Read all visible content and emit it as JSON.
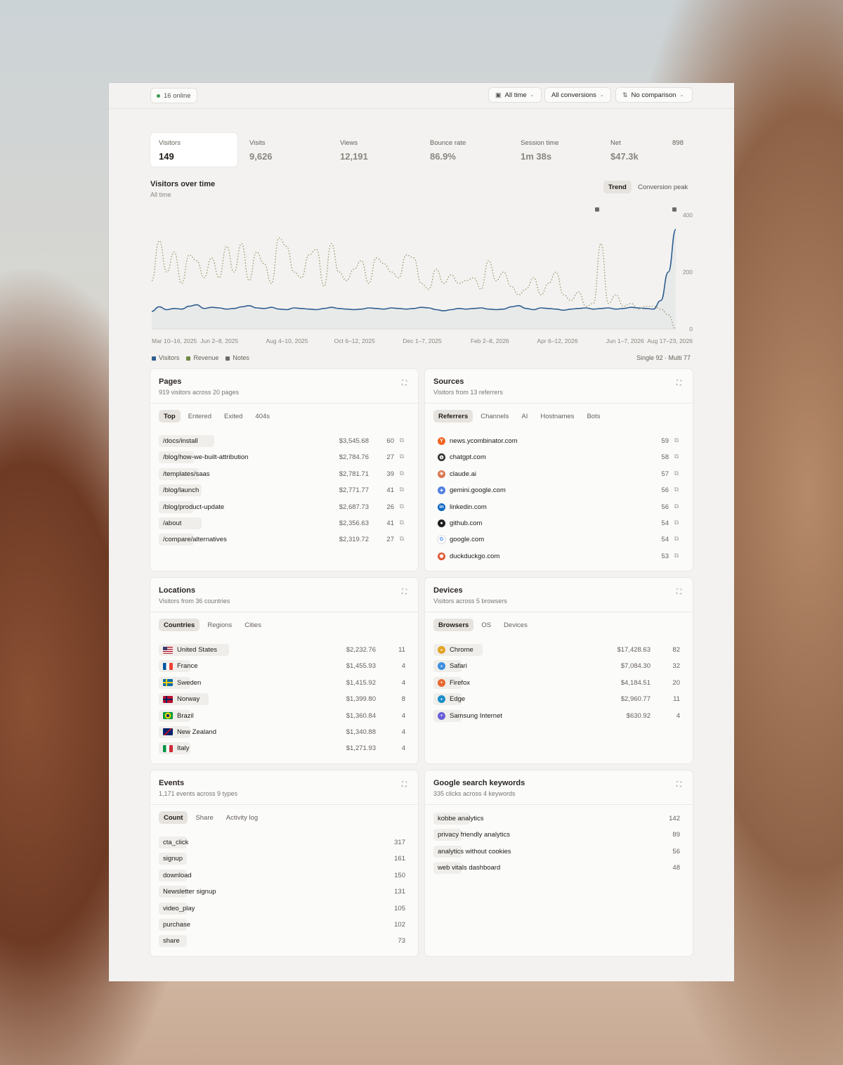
{
  "topbar": {
    "online": "16 online",
    "range": "All time",
    "conversions": "All conversions",
    "comparison": "No comparison"
  },
  "stats": [
    {
      "label": "Visitors",
      "value": "149"
    },
    {
      "label": "Visits",
      "value": "9,626"
    },
    {
      "label": "Views",
      "value": "12,191"
    },
    {
      "label": "Bounce rate",
      "value": "86.9%"
    },
    {
      "label": "Session time",
      "value": "1m 38s"
    },
    {
      "label": "Net",
      "value": "$47.3k"
    }
  ],
  "stats_extra": "898",
  "chart": {
    "title": "Visitors over time",
    "subtitle": "All time",
    "toggle": [
      "Trend",
      "Conversion peak"
    ],
    "legend": [
      "Visitors",
      "Revenue",
      "Notes"
    ],
    "legend_right": "Single 92 · Multi 77"
  },
  "chart_data": {
    "type": "line",
    "x_ticks": [
      "Mar 10–16, 2025",
      "Jun 2–8, 2025",
      "Aug 4–10, 2025",
      "Oct 6–12, 2025",
      "Dec 1–7, 2025",
      "Feb 2–8, 2026",
      "Apr 6–12, 2026",
      "Jun 1–7, 2026",
      "Aug 17–23, 2026"
    ],
    "ylim": [
      0,
      400
    ],
    "y_ticks": [
      "400",
      "200",
      "0"
    ],
    "series": [
      {
        "name": "Visitors",
        "color": "#2f5f91",
        "values": [
          62,
          78,
          68,
          72,
          70,
          80,
          85,
          72,
          76,
          74,
          70,
          72,
          78,
          82,
          74,
          72,
          76,
          70,
          68,
          74,
          72,
          70,
          68,
          72,
          76,
          72,
          70,
          68,
          70,
          74,
          72,
          70,
          74,
          72,
          70,
          72,
          76,
          74,
          68,
          64,
          68,
          72,
          70,
          72,
          74,
          70,
          68,
          70,
          78,
          82,
          72,
          68,
          74,
          72,
          70,
          66,
          70,
          72,
          74,
          70,
          72,
          74,
          70,
          72,
          76,
          74,
          72,
          70,
          100,
          200,
          350
        ]
      },
      {
        "name": "Revenue",
        "color": "#9c946a",
        "values": [
          170,
          310,
          200,
          270,
          160,
          260,
          240,
          180,
          250,
          180,
          290,
          200,
          300,
          170,
          270,
          230,
          160,
          320,
          290,
          200,
          180,
          260,
          280,
          150,
          300,
          200,
          170,
          210,
          240,
          160,
          250,
          230,
          200,
          180,
          260,
          250,
          160,
          140,
          210,
          160,
          190,
          160,
          170,
          180,
          140,
          240,
          170,
          200,
          150,
          120,
          140,
          180,
          120,
          160,
          200,
          120,
          100,
          130,
          80,
          90,
          300,
          90,
          120,
          80,
          90,
          70,
          80,
          80,
          70,
          50,
          0
        ]
      }
    ],
    "notes_markers": [
      "Jul 2026",
      "Aug 2026"
    ]
  },
  "pages": {
    "title": "Pages",
    "subtitle": "919 visitors across 20 pages",
    "tabs": [
      "Top",
      "Entered",
      "Exited",
      "404s"
    ],
    "rows": [
      {
        "label": "/docs/install",
        "money": "$3,545.68",
        "count": "60",
        "share": 0.22
      },
      {
        "label": "/blog/how-we-built-attribution",
        "money": "$2,784.76",
        "count": "27",
        "share": 0.12
      },
      {
        "label": "/templates/saas",
        "money": "$2,781.71",
        "count": "39",
        "share": 0.16
      },
      {
        "label": "/blog/launch",
        "money": "$2,771.77",
        "count": "41",
        "share": 0.17
      },
      {
        "label": "/blog/product-update",
        "money": "$2,687.73",
        "count": "26",
        "share": 0.11
      },
      {
        "label": "/about",
        "money": "$2,356.63",
        "count": "41",
        "share": 0.17
      },
      {
        "label": "/compare/alternatives",
        "money": "$2,319.72",
        "count": "27",
        "share": 0.12
      }
    ]
  },
  "sources": {
    "title": "Sources",
    "subtitle": "Visitors from 13 referrers",
    "tabs": [
      "Referrers",
      "Channels",
      "AI",
      "Hostnames",
      "Bots"
    ],
    "rows": [
      {
        "label": "news.ycombinator.com",
        "icon": "ycombinator-icon",
        "glyph": "Y",
        "color": "#f26522",
        "count": "59"
      },
      {
        "label": "chatgpt.com",
        "icon": "chatgpt-icon",
        "glyph": "❂",
        "color": "#333333",
        "count": "58"
      },
      {
        "label": "claude.ai",
        "icon": "claude-icon",
        "glyph": "✳",
        "color": "#d9774f",
        "count": "57"
      },
      {
        "label": "gemini.google.com",
        "icon": "gemini-icon",
        "glyph": "✦",
        "color": "#4f7fe0",
        "count": "56"
      },
      {
        "label": "linkedin.com",
        "icon": "linkedin-icon",
        "glyph": "in",
        "color": "#0a66c2",
        "count": "56"
      },
      {
        "label": "github.com",
        "icon": "github-icon",
        "glyph": "●",
        "color": "#1e1e1e",
        "count": "54"
      },
      {
        "label": "google.com",
        "icon": "google-icon",
        "glyph": "G",
        "color": "#ffffff",
        "count": "54"
      },
      {
        "label": "duckduckgo.com",
        "icon": "duckduckgo-icon",
        "glyph": "◉",
        "color": "#de5833",
        "count": "53"
      }
    ]
  },
  "locations": {
    "title": "Locations",
    "subtitle": "Visitors from 36 countries",
    "tabs": [
      "Countries",
      "Regions",
      "Cities"
    ],
    "rows": [
      {
        "label": "United States",
        "flag": "us-flag-icon",
        "money": "$2,232.76",
        "count": "11",
        "share": 0.28
      },
      {
        "label": "France",
        "flag": "fr-flag-icon",
        "money": "$1,455.93",
        "count": "4",
        "share": 0.1
      },
      {
        "label": "Sweden",
        "flag": "se-flag-icon",
        "money": "$1,415.92",
        "count": "4",
        "share": 0.1
      },
      {
        "label": "Norway",
        "flag": "no-flag-icon",
        "money": "$1,399.80",
        "count": "8",
        "share": 0.2
      },
      {
        "label": "Brazil",
        "flag": "br-flag-icon",
        "money": "$1,360.84",
        "count": "4",
        "share": 0.1
      },
      {
        "label": "New Zealand",
        "flag": "nz-flag-icon",
        "money": "$1,340.88",
        "count": "4",
        "share": 0.1
      },
      {
        "label": "Italy",
        "flag": "it-flag-icon",
        "money": "$1,271.93",
        "count": "4",
        "share": 0.1
      }
    ]
  },
  "devices": {
    "title": "Devices",
    "subtitle": "Visitors across 5 browsers",
    "tabs": [
      "Browsers",
      "OS",
      "Devices"
    ],
    "rows": [
      {
        "label": "Chrome",
        "icon": "chrome-icon",
        "color": "#e0a526",
        "money": "$17,428.63",
        "count": "82",
        "share": 0.56
      },
      {
        "label": "Safari",
        "icon": "safari-icon",
        "color": "#3d8ee0",
        "money": "$7,084.30",
        "count": "32",
        "share": 0.22
      },
      {
        "label": "Firefox",
        "icon": "firefox-icon",
        "color": "#e8662e",
        "money": "$4,184.51",
        "count": "20",
        "share": 0.14
      },
      {
        "label": "Edge",
        "icon": "edge-icon",
        "color": "#1c8fc9",
        "money": "$2,960.77",
        "count": "11",
        "share": 0.08
      },
      {
        "label": "Samsung Internet",
        "icon": "samsung-internet-icon",
        "color": "#6a5fd8",
        "money": "$630.92",
        "count": "4",
        "share": 0.03
      }
    ]
  },
  "events": {
    "title": "Events",
    "subtitle": "1,171 events across 9 types",
    "tabs": [
      "Count",
      "Share",
      "Activity log"
    ],
    "rows": [
      {
        "label": "cta_click",
        "count": "317",
        "share": 0.27
      },
      {
        "label": "signup",
        "count": "161",
        "share": 0.14
      },
      {
        "label": "download",
        "count": "150",
        "share": 0.13
      },
      {
        "label": "Newsletter signup",
        "count": "131",
        "share": 0.11
      },
      {
        "label": "video_play",
        "count": "105",
        "share": 0.09
      },
      {
        "label": "purchase",
        "count": "102",
        "share": 0.09
      },
      {
        "label": "share",
        "count": "73",
        "share": 0.06
      }
    ]
  },
  "keywords": {
    "title": "Google search keywords",
    "subtitle": "335 clicks across 4 keywords",
    "rows": [
      {
        "label": "kobbe analytics",
        "count": "142",
        "share": 0.42
      },
      {
        "label": "privacy friendly analytics",
        "count": "89",
        "share": 0.27
      },
      {
        "label": "analytics without cookies",
        "count": "56",
        "share": 0.17
      },
      {
        "label": "web vitals dashboard",
        "count": "48",
        "share": 0.14
      }
    ]
  }
}
